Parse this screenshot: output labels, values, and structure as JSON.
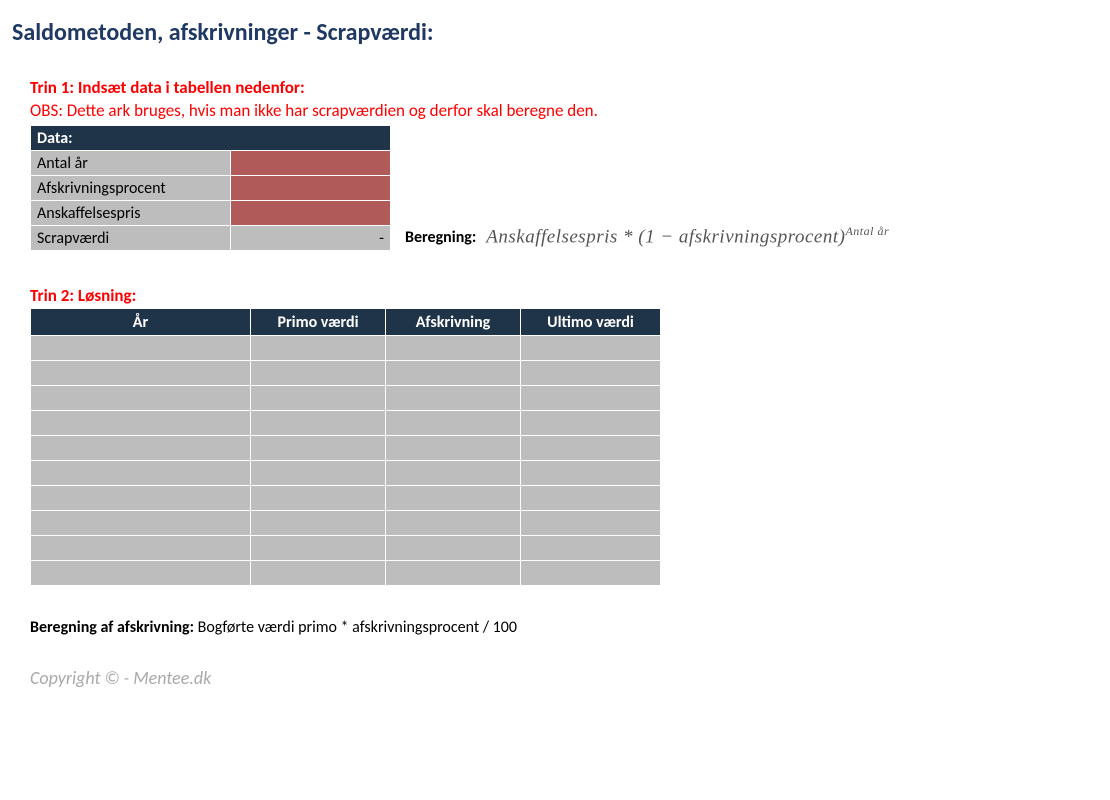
{
  "title": "Saldometoden, afskrivninger - Scrapværdi:",
  "step1": {
    "heading": "Trin 1: Indsæt data i tabellen nedenfor:",
    "note": "OBS: Dette ark bruges, hvis man ikke har scrapværdien og derfor skal beregne den.",
    "header": "Data:",
    "rows": {
      "r1": {
        "label": "Antal år",
        "value": ""
      },
      "r2": {
        "label": "Afskrivningsprocent",
        "value": ""
      },
      "r3": {
        "label": "Anskaffelsespris",
        "value": ""
      },
      "r4": {
        "label": "Scrapværdi",
        "value": "-"
      }
    },
    "calc_label": "Beregning:",
    "formula_main": "Anskaffelsespris * (1 − afskrivningsprocent)",
    "formula_exp": "Antal år"
  },
  "step2": {
    "heading": "Trin 2: Løsning:",
    "cols": {
      "c1": "År",
      "c2": "Primo værdi",
      "c3": "Afskrivning",
      "c4": "Ultimo værdi"
    },
    "row_count": 10
  },
  "calc_afskr": {
    "label": "Beregning af afskrivning: ",
    "text": "Bogførte værdi primo * afskrivningsprocent / 100"
  },
  "copyright": "Copyright © - Mentee.dk"
}
